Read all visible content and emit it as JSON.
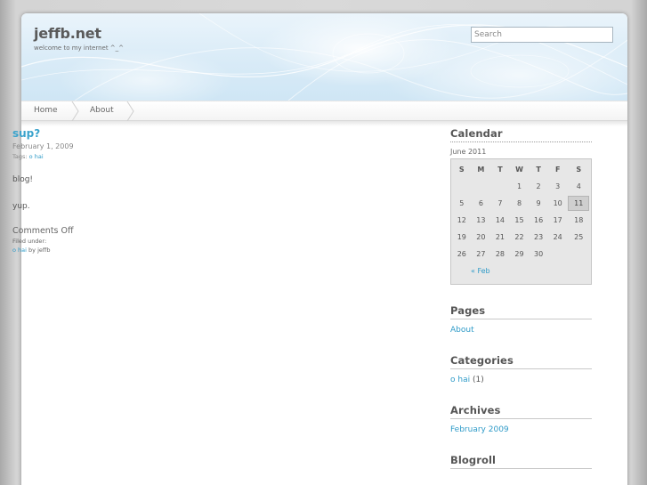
{
  "header": {
    "title": "jeffb.net",
    "description": "welcome to my internet ^_^",
    "search_placeholder": "Search"
  },
  "nav": {
    "items": [
      {
        "label": "Home"
      },
      {
        "label": "About"
      }
    ]
  },
  "post": {
    "title": "sup?",
    "date": "February 1, 2009",
    "tags_label": "Tags:",
    "tag": "o hai",
    "paragraphs": [
      "blog!",
      "yup."
    ],
    "comments": "Comments Off",
    "filed_label": "Filed under:",
    "category": "o hai",
    "by_label": "by",
    "author": "jeffb"
  },
  "sidebar": {
    "calendar": {
      "title": "Calendar",
      "caption": "June 2011",
      "weekdays": [
        "S",
        "M",
        "T",
        "W",
        "T",
        "F",
        "S"
      ],
      "weeks": [
        [
          "",
          "",
          "",
          "1",
          "2",
          "3",
          "4"
        ],
        [
          "5",
          "6",
          "7",
          "8",
          "9",
          "10",
          "11"
        ],
        [
          "12",
          "13",
          "14",
          "15",
          "16",
          "17",
          "18"
        ],
        [
          "19",
          "20",
          "21",
          "22",
          "23",
          "24",
          "25"
        ],
        [
          "26",
          "27",
          "28",
          "29",
          "30",
          "",
          ""
        ]
      ],
      "today": "11",
      "prev_link": "« Feb"
    },
    "pages": {
      "title": "Pages",
      "items": [
        "About"
      ]
    },
    "categories": {
      "title": "Categories",
      "item": "o hai",
      "count": "(1)"
    },
    "archives": {
      "title": "Archives",
      "items": [
        "February 2009"
      ]
    },
    "blogroll": {
      "title": "Blogroll"
    }
  },
  "colors": {
    "link": "#2f9bc8",
    "title": "#3aa3cc",
    "header_bg": "#d9ebf7"
  }
}
